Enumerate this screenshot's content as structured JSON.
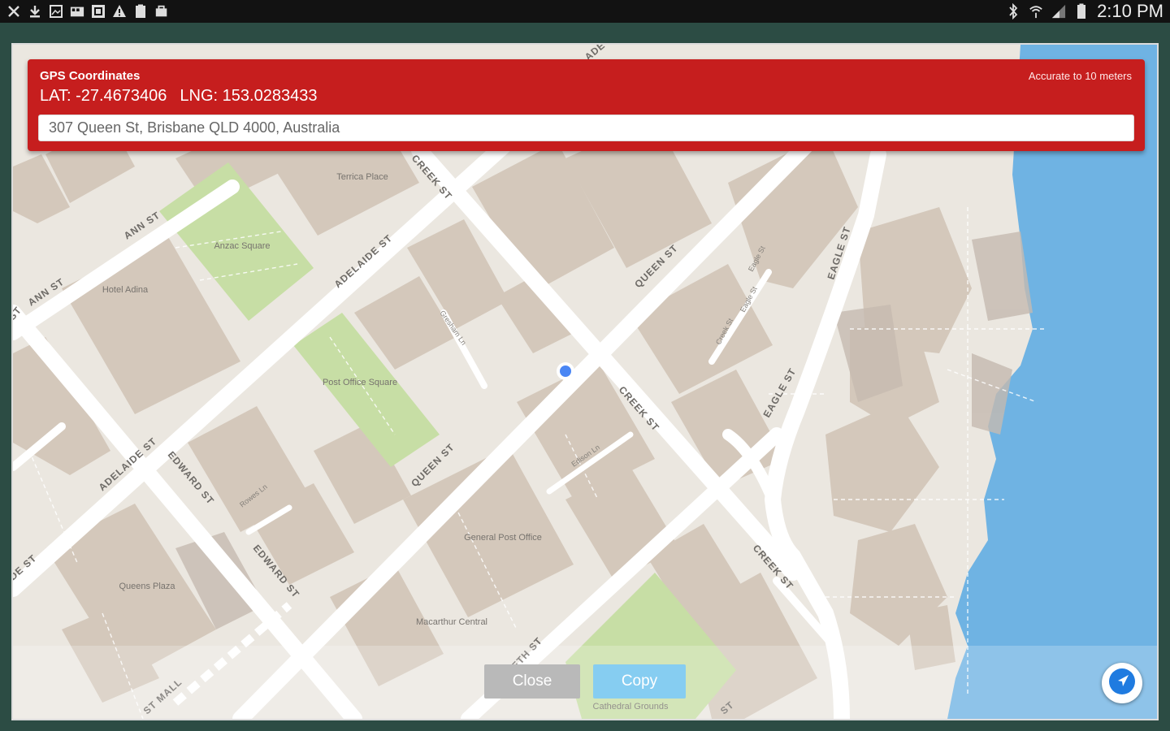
{
  "status_bar": {
    "left_icons": [
      "usb-icon",
      "download-icon",
      "image-icon",
      "photo-album-icon",
      "gallery-icon",
      "warning-icon",
      "clipboard-icon",
      "briefcase-icon"
    ],
    "right_icons": [
      "bluetooth-icon",
      "wifi-icon",
      "signal-icon",
      "battery-icon"
    ],
    "time": "2:10 PM"
  },
  "gps_panel": {
    "title": "GPS Coordinates",
    "lat": "LAT: -27.4673406",
    "lng": "LNG: 153.0283433",
    "accuracy": "Accurate to 10 meters",
    "address": "307 Queen St, Brisbane QLD 4000, Australia"
  },
  "map": {
    "street_labels": [
      "ANN ST",
      "ANN ST",
      "ST",
      "ADELAIDE ST",
      "ADELAIDE ST",
      "DE ST",
      "CREEK ST",
      "CREEK ST",
      "CREEK ST",
      "QUEEN ST",
      "QUEEN ST",
      "EAGLE ST",
      "EAGLE ST",
      "EDWARD ST",
      "EDWARD ST",
      "ZABETH ST",
      "ST",
      "ST MALL",
      "ADE",
      "Creek St",
      "Eagle St",
      "Eagle St",
      "Edison Ln",
      "Gresham Ln",
      "Rowes Ln"
    ],
    "place_labels": [
      "Terrica Place",
      "Anzac Square",
      "Hotel Adina",
      "Post Office Square",
      "General Post Office",
      "Queens Plaza",
      "Macarthur Central",
      "Cathedral Grounds"
    ]
  },
  "buttons": {
    "close": "Close",
    "copy": "Copy"
  },
  "colors": {
    "header": "#c61e1e",
    "copy_button": "#86cdf1",
    "close_button": "#b9b9b9",
    "water": "#6fb3e3",
    "park": "#c7dea5",
    "location_dot": "#4a86f4"
  }
}
